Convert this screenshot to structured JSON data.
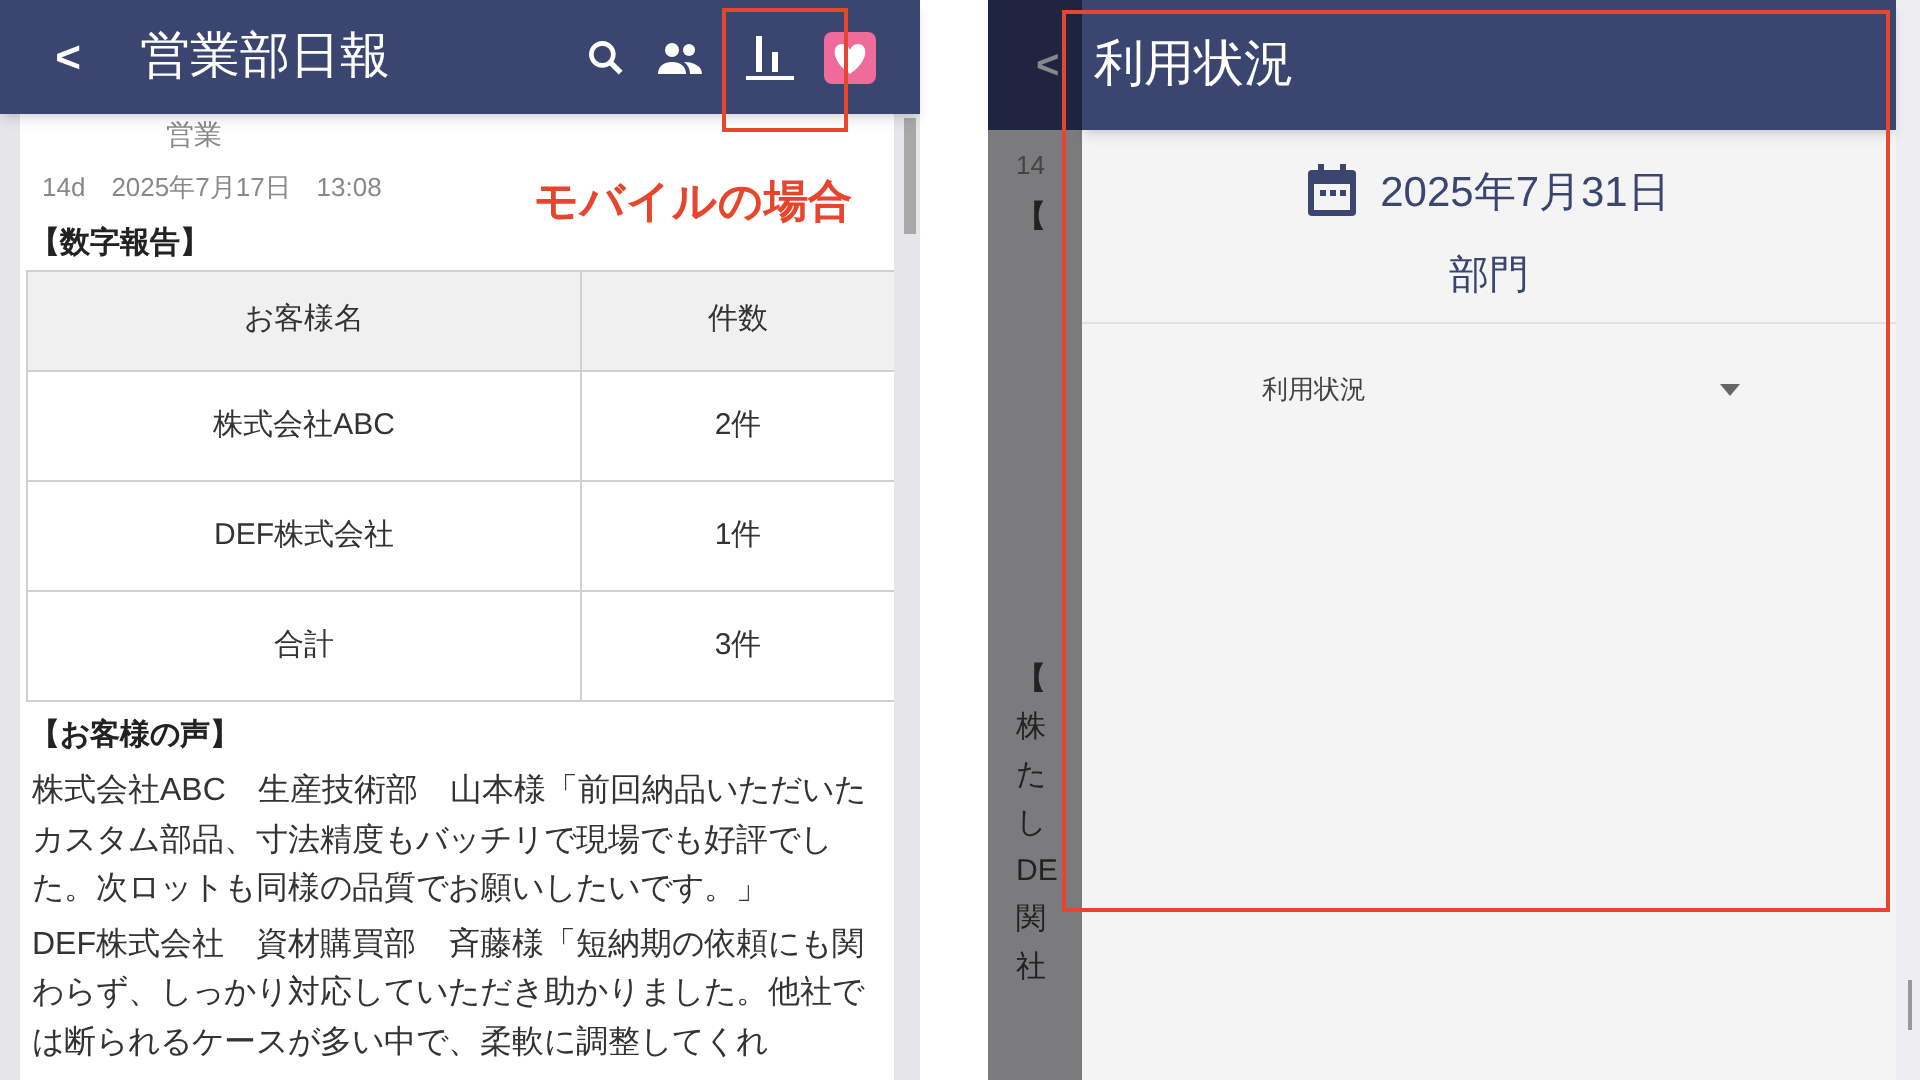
{
  "mobile_screen": {
    "header": {
      "back": "<",
      "title": "営業部日報"
    },
    "author_partial": "営業",
    "meta": "14d　2025年7月17日　13:08",
    "annotation": "モバイルの場合",
    "section_numbers": "【数字報告】",
    "table": {
      "columns": [
        "お客様名",
        "件数"
      ],
      "rows": [
        {
          "cells": [
            "株式会社ABC",
            "2件"
          ]
        },
        {
          "cells": [
            "DEF株式会社",
            "1件"
          ]
        },
        {
          "cells": [
            "合計",
            "3件"
          ]
        }
      ]
    },
    "section_voice": "【お客様の声】",
    "paragraphs": [
      "株式会社ABC　生産技術部　山本様「前回納品いただいたカスタム部品、寸法精度もバッチリで現場でも好評でした。次ロットも同様の品質でお願いしたいです。」",
      "DEF株式会社　資材購買部　斉藤様「短納期の依頼にも関わらず、しっかり対応していただき助かりました。他社では断られるケースが多い中で、柔軟に調整してくれ"
    ]
  },
  "drawer_screen": {
    "background_back": "<",
    "background_fragments": [
      "14",
      "【",
      "【",
      "株",
      "た",
      "し",
      "DE",
      "関",
      "社"
    ],
    "title": "利用状況",
    "date": "2025年7月31日",
    "department": "部門",
    "dropdown": {
      "value": "利用状況"
    }
  }
}
